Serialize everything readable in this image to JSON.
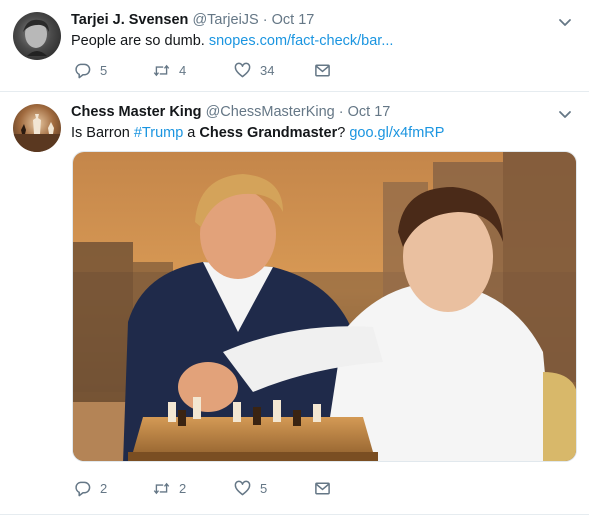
{
  "tweets": [
    {
      "name": "Tarjei J. Svensen",
      "handle": "@TarjeiJS",
      "dot": "·",
      "date": "Oct 17",
      "text": "People are so dumb.",
      "link": "snopes.com/fact-check/bar...",
      "counts": {
        "reply": "5",
        "retweet": "4",
        "like": "34"
      }
    },
    {
      "name": "Chess Master King",
      "handle": "@ChessMasterKing",
      "dot": "·",
      "date": "Oct 17",
      "text_parts": {
        "p1": "Is Barron ",
        "hashtag": "#Trump",
        "p2": " a ",
        "bold": "Chess Grandmaster",
        "p3": "? ",
        "link": "goo.gl/x4fmRP"
      },
      "counts": {
        "reply": "2",
        "retweet": "2",
        "like": "5"
      }
    }
  ],
  "icons": {
    "reply": "reply-icon",
    "retweet": "retweet-icon",
    "like": "heart-icon",
    "dm": "envelope-icon",
    "caret": "chevron-down-icon"
  },
  "colors": {
    "link": "#1b95e0",
    "meta": "#657786",
    "text": "#14171a"
  }
}
